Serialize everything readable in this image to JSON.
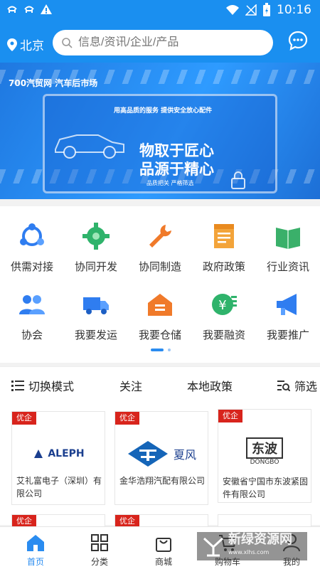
{
  "status": {
    "time": "10:16"
  },
  "header": {
    "location": "北京",
    "search_placeholder": "信息/资讯/企业/产品"
  },
  "banner": {
    "brand": "700汽贸网 汽车后市场",
    "tagline_top": "用高品质的服务  提供安全放心配件",
    "slogan_line1": "物取于匠心",
    "slogan_line2": "品源于精心",
    "slogan_sub": "品质把关    严格筛选"
  },
  "features": [
    {
      "label": "供需对接",
      "icon": "network-icon",
      "color": "#2f7df0"
    },
    {
      "label": "协同开发",
      "icon": "gear-icon",
      "color": "#2fb36b"
    },
    {
      "label": "协同制造",
      "icon": "wrench-icon",
      "color": "#f07a2a"
    },
    {
      "label": "政府政策",
      "icon": "document-icon",
      "color": "#f0a030"
    },
    {
      "label": "行业资讯",
      "icon": "book-icon",
      "color": "#3ab06a"
    },
    {
      "label": "协会",
      "icon": "group-icon",
      "color": "#2f7df0"
    },
    {
      "label": "我要发运",
      "icon": "truck-icon",
      "color": "#2f7df0"
    },
    {
      "label": "我要仓储",
      "icon": "warehouse-icon",
      "color": "#f07a2a"
    },
    {
      "label": "我要融资",
      "icon": "yuan-icon",
      "color": "#2fb36b"
    },
    {
      "label": "我要推广",
      "icon": "megaphone-icon",
      "color": "#2f7df0"
    }
  ],
  "filter": {
    "mode": "切换模式",
    "follow": "关注",
    "local_policy": "本地政策",
    "filter_label": "筛选"
  },
  "cards": [
    {
      "tag": "优企",
      "logo_text": "ALEPH",
      "name": "艾礼富电子（深圳）有限公司"
    },
    {
      "tag": "优企",
      "logo_text": "夏风",
      "name": "金华浩翔汽配有限公司"
    },
    {
      "tag": "优企",
      "logo_text": "东波",
      "logo_sub": "DONGBO",
      "name": "安徽省宁国市东波紧固件有限公司"
    },
    {
      "tag": "优企"
    },
    {
      "tag": "优企"
    }
  ],
  "tabbar": [
    {
      "label": "首页",
      "active": true
    },
    {
      "label": "分类"
    },
    {
      "label": "商城"
    },
    {
      "label": "购物车"
    },
    {
      "label": "我的"
    }
  ],
  "watermark": {
    "text": "新绿资源网",
    "sub": "www.xlhs.com"
  },
  "colors": {
    "primary": "#1a8ff0",
    "tag_red": "#d8241c"
  }
}
